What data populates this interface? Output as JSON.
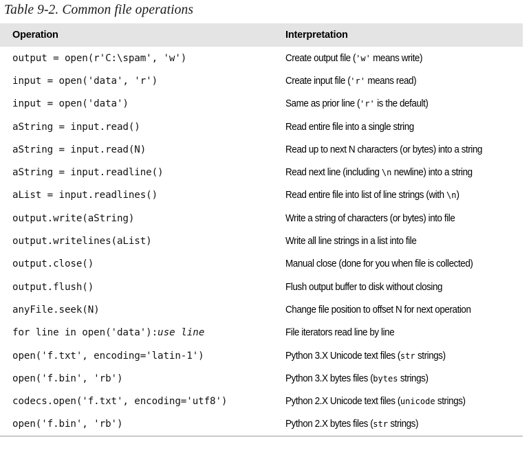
{
  "caption": "Table 9-2. Common file operations",
  "colors": {
    "header_background": "#e4e4e4",
    "text": "#000000",
    "rule": "#9a9a9a",
    "page_background": "#ffffff"
  },
  "table": {
    "columns": [
      {
        "key": "operation",
        "label": "Operation"
      },
      {
        "key": "interpretation",
        "label": "Interpretation"
      }
    ],
    "rows": [
      {
        "operation": "output = open(r'C:\\spam', 'w')",
        "interpretation_parts": [
          {
            "type": "text",
            "value": "Create output file ("
          },
          {
            "type": "code",
            "value": "'w'"
          },
          {
            "type": "text",
            "value": " means write)"
          }
        ]
      },
      {
        "operation": "input = open('data', 'r')",
        "interpretation_parts": [
          {
            "type": "text",
            "value": "Create input file ("
          },
          {
            "type": "code",
            "value": "'r'"
          },
          {
            "type": "text",
            "value": " means read)"
          }
        ]
      },
      {
        "operation": "input = open('data')",
        "interpretation_parts": [
          {
            "type": "text",
            "value": "Same as prior line ("
          },
          {
            "type": "code",
            "value": "'r'"
          },
          {
            "type": "text",
            "value": " is the default)"
          }
        ]
      },
      {
        "operation": "aString = input.read()",
        "interpretation_parts": [
          {
            "type": "text",
            "value": "Read entire file into a single string"
          }
        ]
      },
      {
        "operation": "aString = input.read(N)",
        "interpretation_parts": [
          {
            "type": "text",
            "value": "Read up to next N characters (or bytes) into a string"
          }
        ]
      },
      {
        "operation": "aString = input.readline()",
        "interpretation_parts": [
          {
            "type": "text",
            "value": "Read next line (including "
          },
          {
            "type": "code",
            "value": "\\n"
          },
          {
            "type": "text",
            "value": " newline) into a string"
          }
        ]
      },
      {
        "operation": "aList = input.readlines()",
        "interpretation_parts": [
          {
            "type": "text",
            "value": "Read entire file into list of line strings (with "
          },
          {
            "type": "code",
            "value": "\\n"
          },
          {
            "type": "text",
            "value": ")"
          }
        ]
      },
      {
        "operation": "output.write(aString)",
        "interpretation_parts": [
          {
            "type": "text",
            "value": "Write a string of characters (or bytes) into file"
          }
        ]
      },
      {
        "operation": "output.writelines(aList)",
        "interpretation_parts": [
          {
            "type": "text",
            "value": "Write all line strings in a list into file"
          }
        ]
      },
      {
        "operation": "output.close()",
        "interpretation_parts": [
          {
            "type": "text",
            "value": "Manual close (done for you when file is collected)"
          }
        ]
      },
      {
        "operation": "output.flush()",
        "interpretation_parts": [
          {
            "type": "text",
            "value": "Flush output buffer to disk without closing"
          }
        ]
      },
      {
        "operation": "anyFile.seek(N)",
        "interpretation_parts": [
          {
            "type": "text",
            "value": "Change file position to offset N for next operation"
          }
        ]
      },
      {
        "operation_parts": [
          {
            "type": "code",
            "value": "for line in open('data'):"
          },
          {
            "type": "code-italic",
            "value": "use line"
          }
        ],
        "operation": "for line in open('data'):use line",
        "interpretation_parts": [
          {
            "type": "text",
            "value": "File iterators read line by line"
          }
        ]
      },
      {
        "operation": "open('f.txt', encoding='latin-1')",
        "interpretation_parts": [
          {
            "type": "text",
            "value": "Python 3.X Unicode text files ("
          },
          {
            "type": "code",
            "value": "str"
          },
          {
            "type": "text",
            "value": " strings)"
          }
        ]
      },
      {
        "operation": "open('f.bin', 'rb')",
        "interpretation_parts": [
          {
            "type": "text",
            "value": "Python 3.X bytes files ("
          },
          {
            "type": "code",
            "value": "bytes"
          },
          {
            "type": "text",
            "value": " strings)"
          }
        ]
      },
      {
        "operation": "codecs.open('f.txt', encoding='utf8')",
        "interpretation_parts": [
          {
            "type": "text",
            "value": "Python 2.X Unicode text files ("
          },
          {
            "type": "code",
            "value": "unicode"
          },
          {
            "type": "text",
            "value": " strings)"
          }
        ]
      },
      {
        "operation": "open('f.bin', 'rb')",
        "interpretation_parts": [
          {
            "type": "text",
            "value": "Python 2.X bytes files ("
          },
          {
            "type": "code",
            "value": "str"
          },
          {
            "type": "text",
            "value": " strings)"
          }
        ]
      }
    ]
  }
}
